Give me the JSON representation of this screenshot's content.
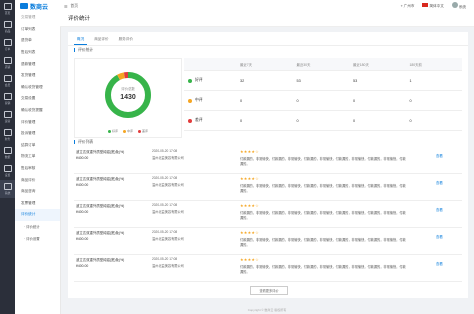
{
  "app": {
    "name": "数商云",
    "brand_color": "#0a7ddc",
    "breadcrumb_home": "首页",
    "breadcrumb_current": ""
  },
  "topbar": {
    "region": "广州市",
    "language": "简体中文",
    "user": "系统"
  },
  "rail": [
    {
      "label": "首页",
      "icon": "home-icon"
    },
    {
      "label": "商品",
      "icon": "goods-icon"
    },
    {
      "label": "订单",
      "icon": "order-icon"
    },
    {
      "label": "店铺",
      "icon": "shop-icon"
    },
    {
      "label": "会员",
      "icon": "member-icon"
    },
    {
      "label": "营销",
      "icon": "marketing-icon"
    },
    {
      "label": "运营",
      "icon": "operation-icon"
    },
    {
      "label": "财务",
      "icon": "finance-icon"
    },
    {
      "label": "数据",
      "icon": "data-icon"
    },
    {
      "label": "设置",
      "icon": "settings-icon"
    },
    {
      "label": "系统",
      "icon": "system-icon"
    }
  ],
  "sidenav": {
    "header": "交易管理",
    "items": [
      {
        "label": "订单列表",
        "active": false
      },
      {
        "label": "退货单",
        "active": false
      },
      {
        "label": "售后列表",
        "active": false
      },
      {
        "label": "退款管理",
        "active": false
      },
      {
        "label": "发货管理",
        "active": false
      },
      {
        "label": "确认收货管理",
        "active": false
      },
      {
        "label": "交易设置",
        "active": false
      },
      {
        "label": "确认收货提醒",
        "active": false
      },
      {
        "label": "评价管理",
        "active": false
      },
      {
        "label": "投诉管理",
        "active": false
      },
      {
        "label": "结算订单",
        "active": false
      },
      {
        "label": "物流工单",
        "active": false
      },
      {
        "label": "售后审核",
        "active": false
      },
      {
        "label": "商品评价",
        "active": false
      },
      {
        "label": "商品咨询",
        "active": false
      },
      {
        "label": "发票管理",
        "active": false
      },
      {
        "label": "评价统计",
        "active": true
      },
      {
        "label": "· 评价统计",
        "active": false
      },
      {
        "label": "· 评价设置",
        "active": false
      }
    ]
  },
  "page": {
    "title": "评价统计"
  },
  "tabs": [
    {
      "label": "概况",
      "active": true
    },
    {
      "label": "商品评价",
      "active": false
    },
    {
      "label": "服务评价",
      "active": false
    }
  ],
  "summary": {
    "section_title": "评价统计",
    "center_label": "评价总数",
    "total": "1430",
    "legend": [
      {
        "label": "好评",
        "color": "#37b44a"
      },
      {
        "label": "中评",
        "color": "#f5a623"
      },
      {
        "label": "差评",
        "color": "#e23c3c"
      }
    ],
    "donut": {
      "good": 0.92,
      "neutral": 0.05,
      "bad": 0.03
    }
  },
  "stat_table": {
    "columns": [
      "",
      "最近7天",
      "最近30天",
      "最近180天",
      "180天前"
    ],
    "rows": [
      {
        "type": "好评",
        "values": [
          "32",
          "53",
          "53",
          "1"
        ]
      },
      {
        "type": "中评",
        "values": [
          "0",
          "0",
          "0",
          "0"
        ]
      },
      {
        "type": "差评",
        "values": [
          "0",
          "0",
          "0",
          "0"
        ]
      }
    ]
  },
  "reviews": {
    "section_title": "评价列表",
    "action_label": "查看",
    "more_label": "查看更多评价",
    "items": [
      {
        "product": "波立达双重外质型纯铝(宽)免(%)",
        "price": "¥400.00",
        "time": "2020-05-20 17:08",
        "user": "温州北益美容有限公司",
        "stars": 4,
        "content": "付款漏的，非常愉快，付款漏的，非常愉快，付款漏的，非常愉快，付款漏的，非常愉快，付款漏的，非常愉快，付款漏的。"
      },
      {
        "product": "波立达双重外质型纯铝(宽)免(%)",
        "price": "¥400.00",
        "time": "2020-05-20 17:08",
        "user": "温州北益美容有限公司",
        "stars": 4,
        "content": "付款漏的，非常愉快，付款漏的，非常愉快，付款漏的，非常愉快，付款漏的，非常愉快，付款漏的，非常愉快，付款漏的。"
      },
      {
        "product": "波立达双重外质型纯铝(宽)免(%)",
        "price": "¥400.00",
        "time": "2020-05-20 17:08",
        "user": "温州北益美容有限公司",
        "stars": 4,
        "content": "付款漏的，非常愉快，付款漏的，非常愉快，付款漏的，非常愉快，付款漏的，非常愉快，付款漏的，非常愉快，付款漏的。"
      },
      {
        "product": "波立达双重外质型纯铝(宽)免(%)",
        "price": "¥400.00",
        "time": "2020-05-20 17:08",
        "user": "温州北益美容有限公司",
        "stars": 4,
        "content": "付款漏的，非常愉快，付款漏的，非常愉快，付款漏的，非常愉快，付款漏的，非常愉快，付款漏的，非常愉快，付款漏的。"
      },
      {
        "product": "波立达双重外质型纯铝(宽)免(%)",
        "price": "¥400.00",
        "time": "2020-05-20 17:08",
        "user": "温州北益美容有限公司",
        "stars": 4,
        "content": "付款漏的，非常愉快，付款漏的，非常愉快，付款漏的，非常愉快，付款漏的，非常愉快，付款漏的，非常愉快，付款漏的。"
      }
    ]
  },
  "footer": "Copyright © 数商云 版权所有"
}
